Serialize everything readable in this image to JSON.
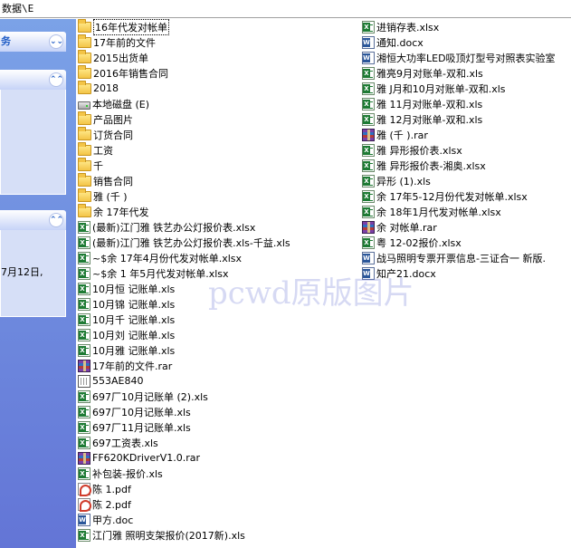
{
  "address_bar": {
    "path": "数据\\E"
  },
  "taskpane": {
    "panel1_icon": "chevron-down-double",
    "panel2_icon": "chevron-up-double",
    "panel3_icon": "chevron-up-double",
    "date_text": "7月12日,"
  },
  "watermark": "pcwd原版图片",
  "files_left": [
    {
      "icon": "folder",
      "name": "16年代发对帐单",
      "selected": true
    },
    {
      "icon": "folder",
      "name": "17年前的文件"
    },
    {
      "icon": "folder",
      "name": "2015出货单"
    },
    {
      "icon": "folder",
      "name": "2016年销售合同"
    },
    {
      "icon": "folder",
      "name": "2018"
    },
    {
      "icon": "drive",
      "name": "本地磁盘 (E)"
    },
    {
      "icon": "folder",
      "name": "产品图片"
    },
    {
      "icon": "folder",
      "name": "订货合同"
    },
    {
      "icon": "folder",
      "name": "工资"
    },
    {
      "icon": "folder",
      "name": "千"
    },
    {
      "icon": "folder",
      "name": "销售合同"
    },
    {
      "icon": "folder",
      "name": "雅  (千  )"
    },
    {
      "icon": "folder",
      "name": "余   17年代发"
    },
    {
      "icon": "xls",
      "name": "(最新)江门雅  铁艺办公灯报价表.xlsx"
    },
    {
      "icon": "xls",
      "name": "(最新)江门雅  铁艺办公灯报价表.xls-千益.xls"
    },
    {
      "icon": "xls",
      "name": "~$余   17年4月份代发对帐单.xlsx"
    },
    {
      "icon": "xls",
      "name": "~$余   1 年5月代发对帐单.xlsx"
    },
    {
      "icon": "xls",
      "name": "10月恒   记账单.xls"
    },
    {
      "icon": "xls",
      "name": "10月锦   记账单.xls"
    },
    {
      "icon": "xls",
      "name": "10月千   记账单.xls"
    },
    {
      "icon": "xls",
      "name": "10月刘   记账单.xls"
    },
    {
      "icon": "xls",
      "name": "10月雅   记账单.xls"
    },
    {
      "icon": "rar",
      "name": "17年前的文件.rar"
    },
    {
      "icon": "file",
      "name": "553AE840"
    },
    {
      "icon": "xls",
      "name": "697厂10月记账单 (2).xls"
    },
    {
      "icon": "xls",
      "name": "697厂10月记账单.xls"
    },
    {
      "icon": "xls",
      "name": "697厂11月记账单.xls"
    },
    {
      "icon": "xls",
      "name": "697工资表.xls"
    },
    {
      "icon": "rar",
      "name": "FF620KDriverV1.0.rar"
    },
    {
      "icon": "xls",
      "name": "补包装-报价.xls"
    },
    {
      "icon": "pdf",
      "name": "陈  1.pdf"
    },
    {
      "icon": "pdf",
      "name": "陈  2.pdf"
    },
    {
      "icon": "doc",
      "name": "甲方.doc"
    },
    {
      "icon": "xls",
      "name": "江门雅  照明支架报价(2017新).xls"
    }
  ],
  "files_right": [
    {
      "icon": "xls",
      "name": "进销存表.xlsx"
    },
    {
      "icon": "doc",
      "name": "通知.docx"
    },
    {
      "icon": "doc",
      "name": "湘恒大功率LED吸顶灯型号对照表实验室"
    },
    {
      "icon": "xls",
      "name": "雅亮9月对账单-双和.xls"
    },
    {
      "icon": "xls",
      "name": "雅  J月和10月对账单-双和.xls"
    },
    {
      "icon": "xls",
      "name": "雅  11月对账单-双和.xls"
    },
    {
      "icon": "xls",
      "name": "雅  12月对账单-双和.xls"
    },
    {
      "icon": "rar",
      "name": "雅  (千  ).rar"
    },
    {
      "icon": "xls",
      "name": "雅  异形报价表.xlsx"
    },
    {
      "icon": "xls",
      "name": "雅  异形报价表-湘奥.xlsx"
    },
    {
      "icon": "xls",
      "name": "异形 (1).xls"
    },
    {
      "icon": "xls",
      "name": "余   17年5-12月份代发对帐单.xlsx"
    },
    {
      "icon": "xls",
      "name": "余   18年1月代发对帐单.xlsx"
    },
    {
      "icon": "rar",
      "name": "余   对帐单.rar"
    },
    {
      "icon": "xls",
      "name": "粤   12-02报价.xlsx"
    },
    {
      "icon": "doc",
      "name": "战马照明专票开票信息-三证合一 新版."
    },
    {
      "icon": "doc",
      "name": "知产21.docx"
    }
  ]
}
